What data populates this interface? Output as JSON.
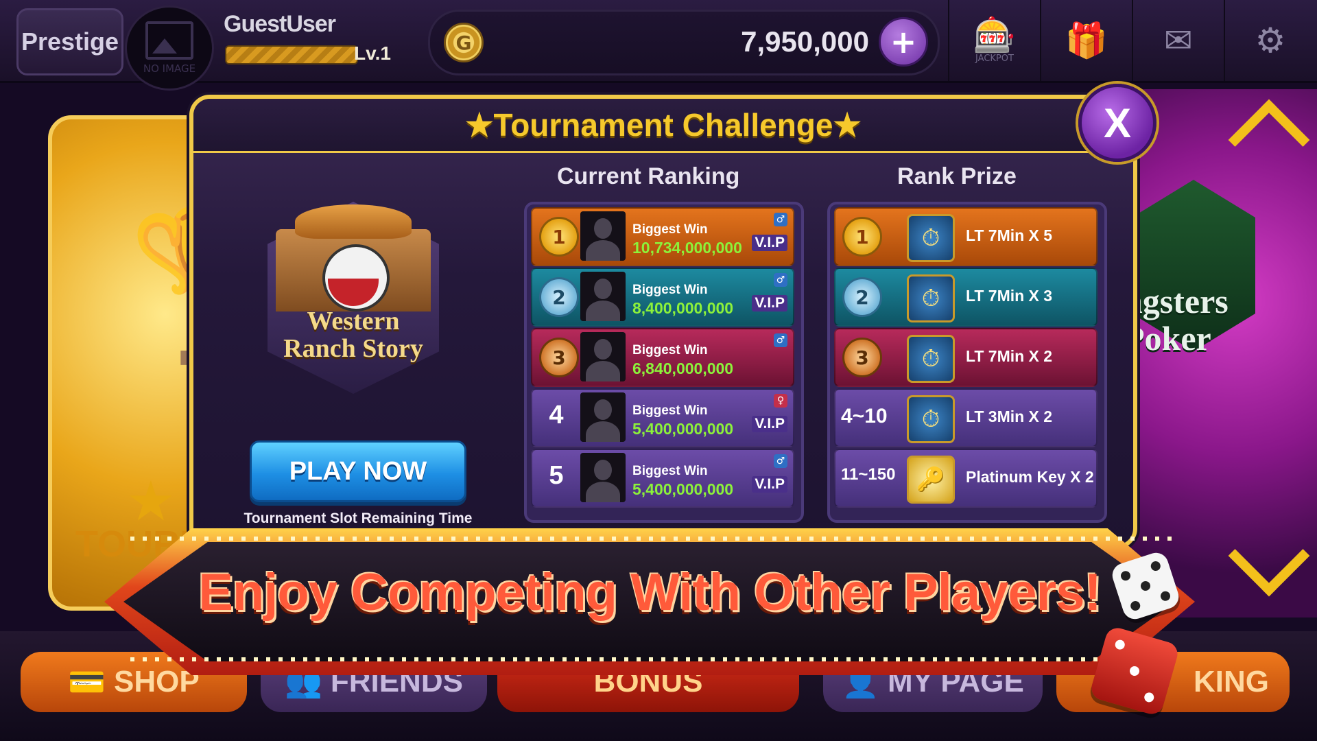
{
  "topbar": {
    "prestige_label": "Prestige",
    "avatar_placeholder": "NO IMAGE",
    "username": "GuestUser",
    "level": "Lv.1",
    "level_progress": 0.85,
    "coin_icon": "G",
    "coins": "7,950,000",
    "add_coins_label": "+",
    "jackpot_label": "JACKPOT",
    "icons": [
      "slot-machine-icon",
      "gift-icon",
      "mail-icon",
      "gear-icon"
    ]
  },
  "background": {
    "left_card_label": "TOURN",
    "right_game_line1": "ngsters",
    "right_game_line2": "Poker"
  },
  "modal": {
    "title": "★Tournament Challenge★",
    "close_label": "X",
    "slot_name_line1": "Western",
    "slot_name_line2": "Ranch Story",
    "play_button": "PLAY NOW",
    "remaining_time_label": "Tournament Slot Remaining Time",
    "ranking_header": "Current Ranking",
    "prize_header": "Rank Prize",
    "rankings": [
      {
        "rank": "1",
        "medal": "FIRST",
        "label": "Biggest Win",
        "value": "10,734,000,000",
        "vip": "V.I.P",
        "gender": "male"
      },
      {
        "rank": "2",
        "medal": "SECOND",
        "label": "Biggest Win",
        "value": "8,400,000,000",
        "vip": "V.I.P",
        "gender": "male"
      },
      {
        "rank": "3",
        "medal": "THIRD",
        "label": "Biggest Win",
        "value": "6,840,000,000",
        "vip": "",
        "gender": "male"
      },
      {
        "rank": "4",
        "medal": "",
        "label": "Biggest Win",
        "value": "5,400,000,000",
        "vip": "V.I.P",
        "gender": "female"
      },
      {
        "rank": "5",
        "medal": "",
        "label": "Biggest Win",
        "value": "5,400,000,000",
        "vip": "V.I.P",
        "gender": "male"
      }
    ],
    "prizes": [
      {
        "rank": "1",
        "medal": "FIRST",
        "icon": "lucky-time-icon",
        "text": "LT 7Min X 5"
      },
      {
        "rank": "2",
        "medal": "SECOND",
        "icon": "lucky-time-icon",
        "text": "LT 7Min X 3"
      },
      {
        "rank": "3",
        "medal": "THIRD",
        "icon": "lucky-time-icon",
        "text": "LT 7Min X 2"
      },
      {
        "rank": "4~10",
        "medal": "",
        "icon": "lucky-time-icon",
        "text": "LT 3Min X 2"
      },
      {
        "rank": "11~150",
        "medal": "",
        "icon": "platinum-key-icon",
        "text": "Platinum Key X 2"
      }
    ]
  },
  "banner": {
    "text": "Enjoy Competing With Other Players!"
  },
  "bottom_nav": {
    "shop": "SHOP",
    "friends": "FRIENDS",
    "bonus": "BONUS",
    "mypage": "MY PAGE",
    "ranking": "KING"
  },
  "colors": {
    "modal_border": "#f0c948",
    "title_gold": "#f6c92c",
    "win_value_green": "#8cf23a",
    "play_button_blue": "#1e8fe4"
  }
}
